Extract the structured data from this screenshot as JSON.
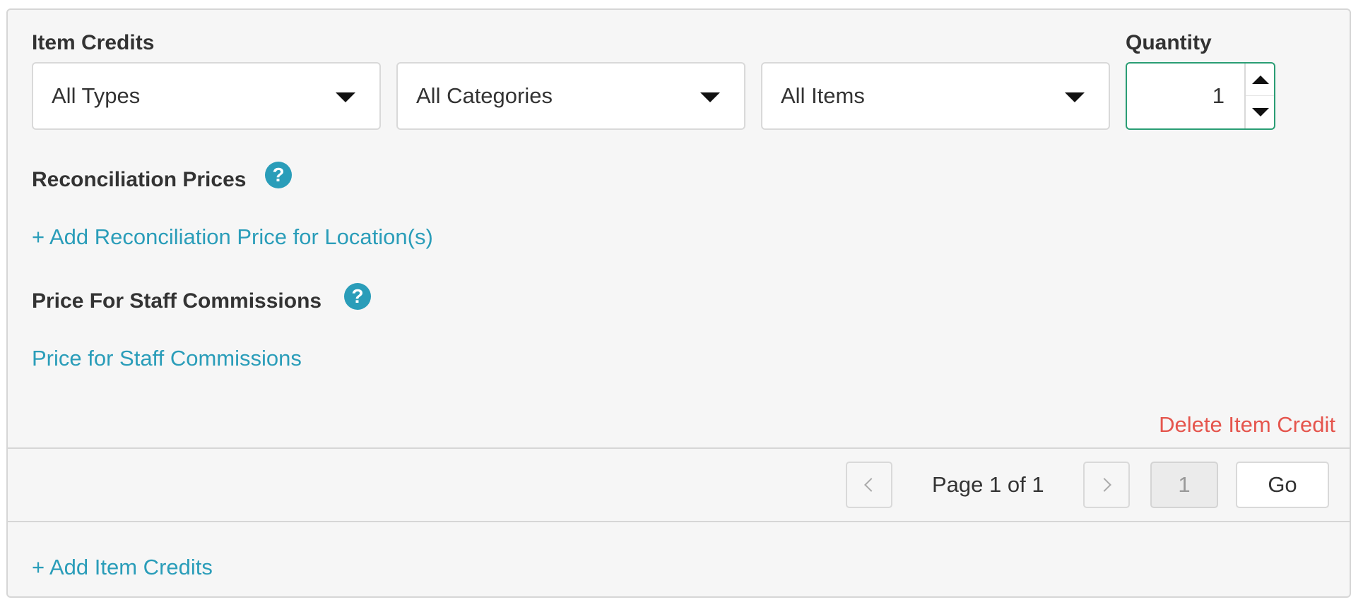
{
  "item_credits": {
    "label": "Item Credits",
    "type_select": {
      "value": "All Types"
    },
    "category_select": {
      "value": "All Categories"
    },
    "item_select": {
      "value": "All Items"
    }
  },
  "quantity": {
    "label": "Quantity",
    "value": "1"
  },
  "reconciliation": {
    "heading": "Reconciliation Prices",
    "help_glyph": "?",
    "add_link": "+ Add Reconciliation Price for Location(s)"
  },
  "commissions": {
    "heading": "Price For Staff Commissions",
    "help_glyph": "?",
    "link": "Price for Staff Commissions"
  },
  "delete_link": "Delete Item Credit",
  "pagination": {
    "page_text": "Page 1 of 1",
    "page_input": "1",
    "go_label": "Go"
  },
  "add_item_credits": "+ Add Item Credits",
  "colors": {
    "accent": "#2a9db9",
    "danger": "#e5554d",
    "focus_border": "#2a9d74",
    "panel_bg": "#f6f6f6"
  }
}
